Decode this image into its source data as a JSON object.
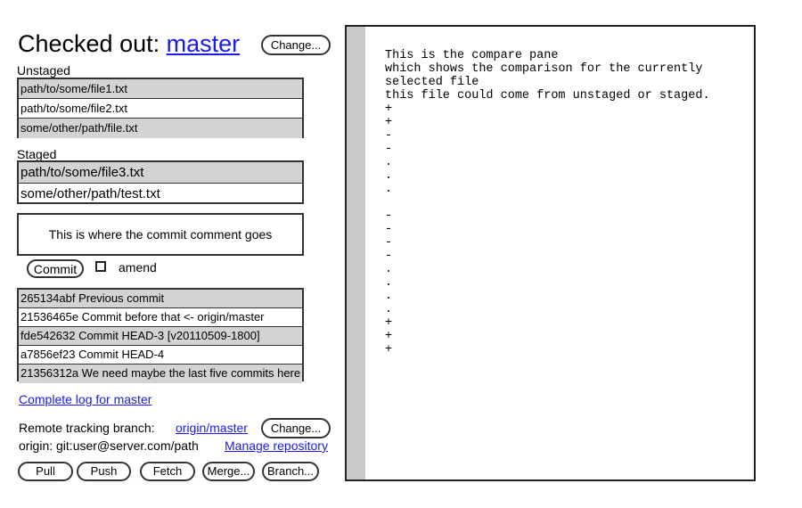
{
  "header": {
    "title_prefix": "Checked out:",
    "branch": "master",
    "change_label": "Change..."
  },
  "unstaged": {
    "label": "Unstaged",
    "files": [
      {
        "path": "path/to/some/file1.txt"
      },
      {
        "path": "path/to/some/file2.txt"
      },
      {
        "path": "some/other/path/file.txt"
      }
    ]
  },
  "staged": {
    "label": "Staged",
    "files": [
      {
        "path": "path/to/some/file3.txt"
      },
      {
        "path": "some/other/path/test.txt"
      }
    ]
  },
  "commit": {
    "placeholder": "This is where the commit comment goes",
    "button_label": "Commit",
    "amend_label": "amend"
  },
  "log": {
    "entries": [
      "265134abf  Previous commit",
      "21536465e Commit before that <- origin/master",
      "fde542632 Commit HEAD-3 [v20110509-1800]",
      "a7856ef23 Commit HEAD-4",
      "21356312a We need maybe the last five commits here"
    ],
    "complete_log_link": "Complete log for master"
  },
  "remote": {
    "tracking_label": "Remote tracking branch:",
    "tracking_branch": "origin/master",
    "change_label": "Change...",
    "origin_text": "origin: git:user@server.com/path",
    "manage_link": "Manage repository"
  },
  "actions": {
    "pull": "Pull",
    "push": "Push",
    "fetch": "Fetch",
    "merge": "Merge...",
    "branch": "Branch..."
  },
  "compare": {
    "text": "This is the compare pane\nwhich shows the comparison for the currently\nselected file\nthis file could come from unstaged or staged.\n+\n+\n-\n-\n.\n.\n.\n\n-\n-\n-\n-\n.\n.\n.\n.\n+\n+\n+"
  }
}
